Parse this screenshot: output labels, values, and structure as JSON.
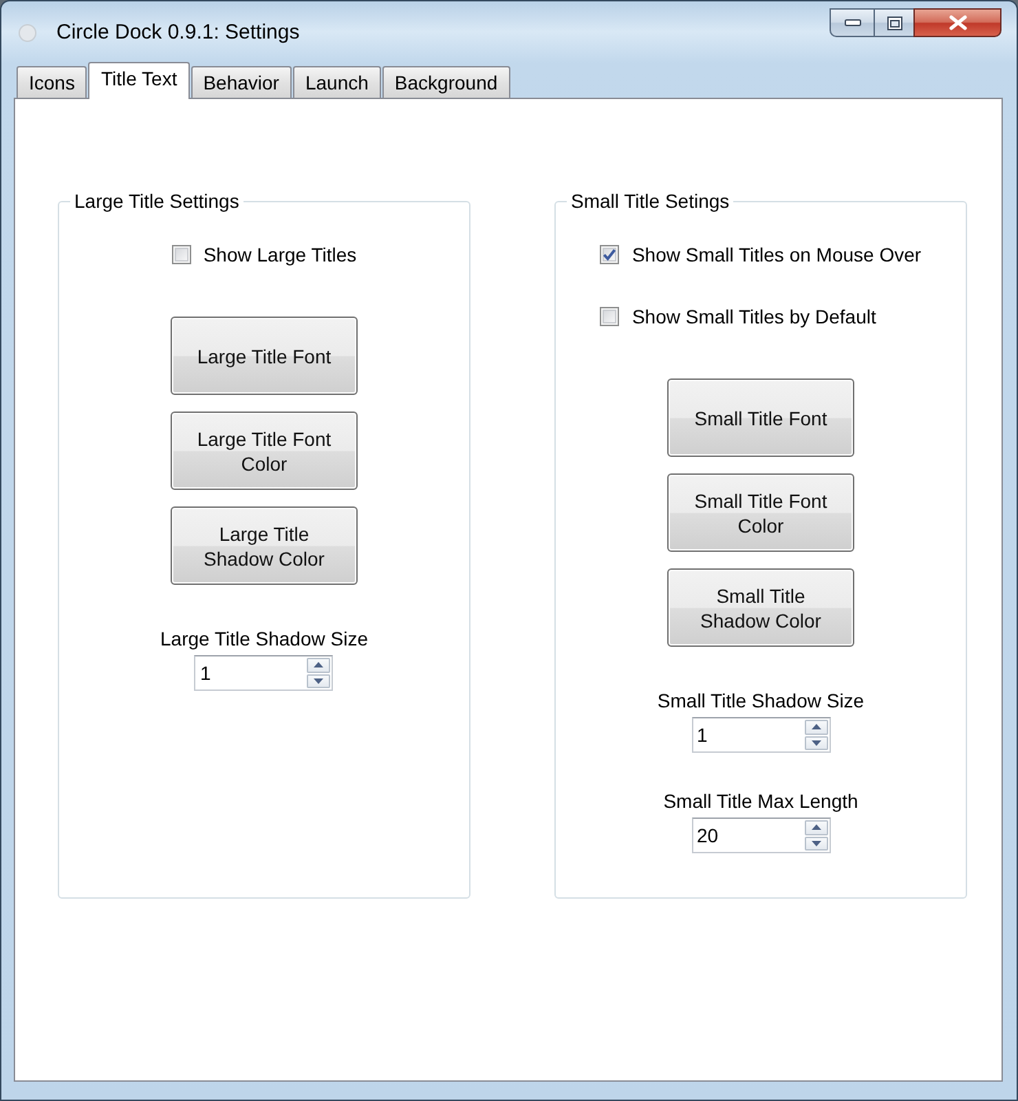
{
  "window": {
    "title": "Circle Dock 0.9.1: Settings"
  },
  "tabs": [
    {
      "label": "Icons",
      "selected": false
    },
    {
      "label": "Title Text",
      "selected": true
    },
    {
      "label": "Behavior",
      "selected": false
    },
    {
      "label": "Launch",
      "selected": false
    },
    {
      "label": "Background",
      "selected": false
    }
  ],
  "groups": [
    {
      "title": "Large Title Settings",
      "checkboxes": [
        {
          "label": "Show Large Titles",
          "checked": false
        }
      ],
      "buttons": [
        "Large Title Font",
        "Large Title Font Color",
        "Large Title Shadow Color"
      ],
      "spinners": [
        {
          "label": "Large Title Shadow Size",
          "value": "1"
        }
      ]
    },
    {
      "title": "Small Title Setings",
      "checkboxes": [
        {
          "label": "Show Small Titles on Mouse Over",
          "checked": true
        },
        {
          "label": "Show Small Titles by Default",
          "checked": false
        }
      ],
      "buttons": [
        "Small Title Font",
        "Small Title Font Color",
        "Small Title Shadow Color"
      ],
      "spinners": [
        {
          "label": "Small Title Shadow Size",
          "value": "1"
        },
        {
          "label": "Small Title Max Length",
          "value": "20"
        }
      ]
    }
  ]
}
